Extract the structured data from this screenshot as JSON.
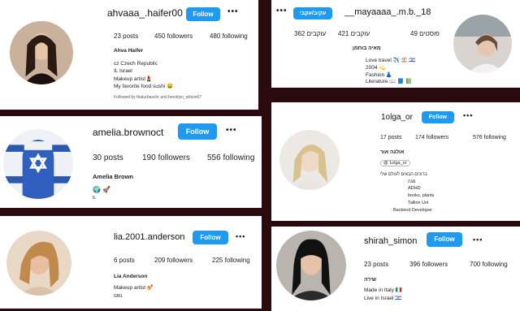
{
  "profiles": [
    {
      "username": "ahvaaa_.haifer00",
      "follow_label": "Follow",
      "posts": "23 posts",
      "followers": "450 followers",
      "following": "480 following",
      "name": "Ahva Haifer",
      "bio": [
        "cz Czech Republic",
        "IL Israel",
        "Makeup artist💄",
        "My favorite food sushi 😀"
      ],
      "followed_by": "Followed by thaturbaschr and brooklyn_wilson07"
    },
    {
      "username": "__mayaaaa_.m.b._18",
      "follow_label": "עקוב/עקבי",
      "posts": "49 פוסטים",
      "followers": "421 עוקבים",
      "following": "362 עוקבים",
      "name": "מאיה בוחמן",
      "bio": [
        "Love travel ✈️ 🏖️ 🇮🇱",
        "2004 💫",
        "Fashion 👗",
        "Literature 📖 📘 📗"
      ]
    },
    {
      "username": "amelia.brownoct",
      "follow_label": "Follow",
      "posts": "30 posts",
      "followers": "190 followers",
      "following": "556 following",
      "name": "Amelia Brown",
      "bio": [
        "🌍 🚀",
        "IL"
      ]
    },
    {
      "username": "1olga_or",
      "follow_label": "Follow",
      "posts": "17 posts",
      "followers": "174 followers",
      "following": "576 following",
      "name": "אולגה אור",
      "threads": "1olga_or",
      "bio": [
        "ברוכים הבאים לעולם שלי",
        "מגה",
        "ADHD",
        "books, plants",
        "Tallinn Uni",
        "Backend Developer"
      ]
    },
    {
      "username": "lia.2001.anderson",
      "follow_label": "Follow",
      "posts": "6 posts",
      "followers": "209 followers",
      "following": "225 following",
      "name": "Lia Anderson",
      "bio": [
        "Makeup artist 💅",
        "GBIL"
      ]
    },
    {
      "username": "shirah_simon",
      "follow_label": "Follow",
      "posts": "23 posts",
      "followers": "396 followers",
      "following": "700 following",
      "name": "שירה",
      "bio": [
        "Made in Italy 🇮🇹",
        "Live in Israel 🇮🇱"
      ]
    }
  ],
  "more_label": "•••",
  "colors": {
    "follow": "#1e9bf0",
    "background": "#2a0a0f"
  }
}
